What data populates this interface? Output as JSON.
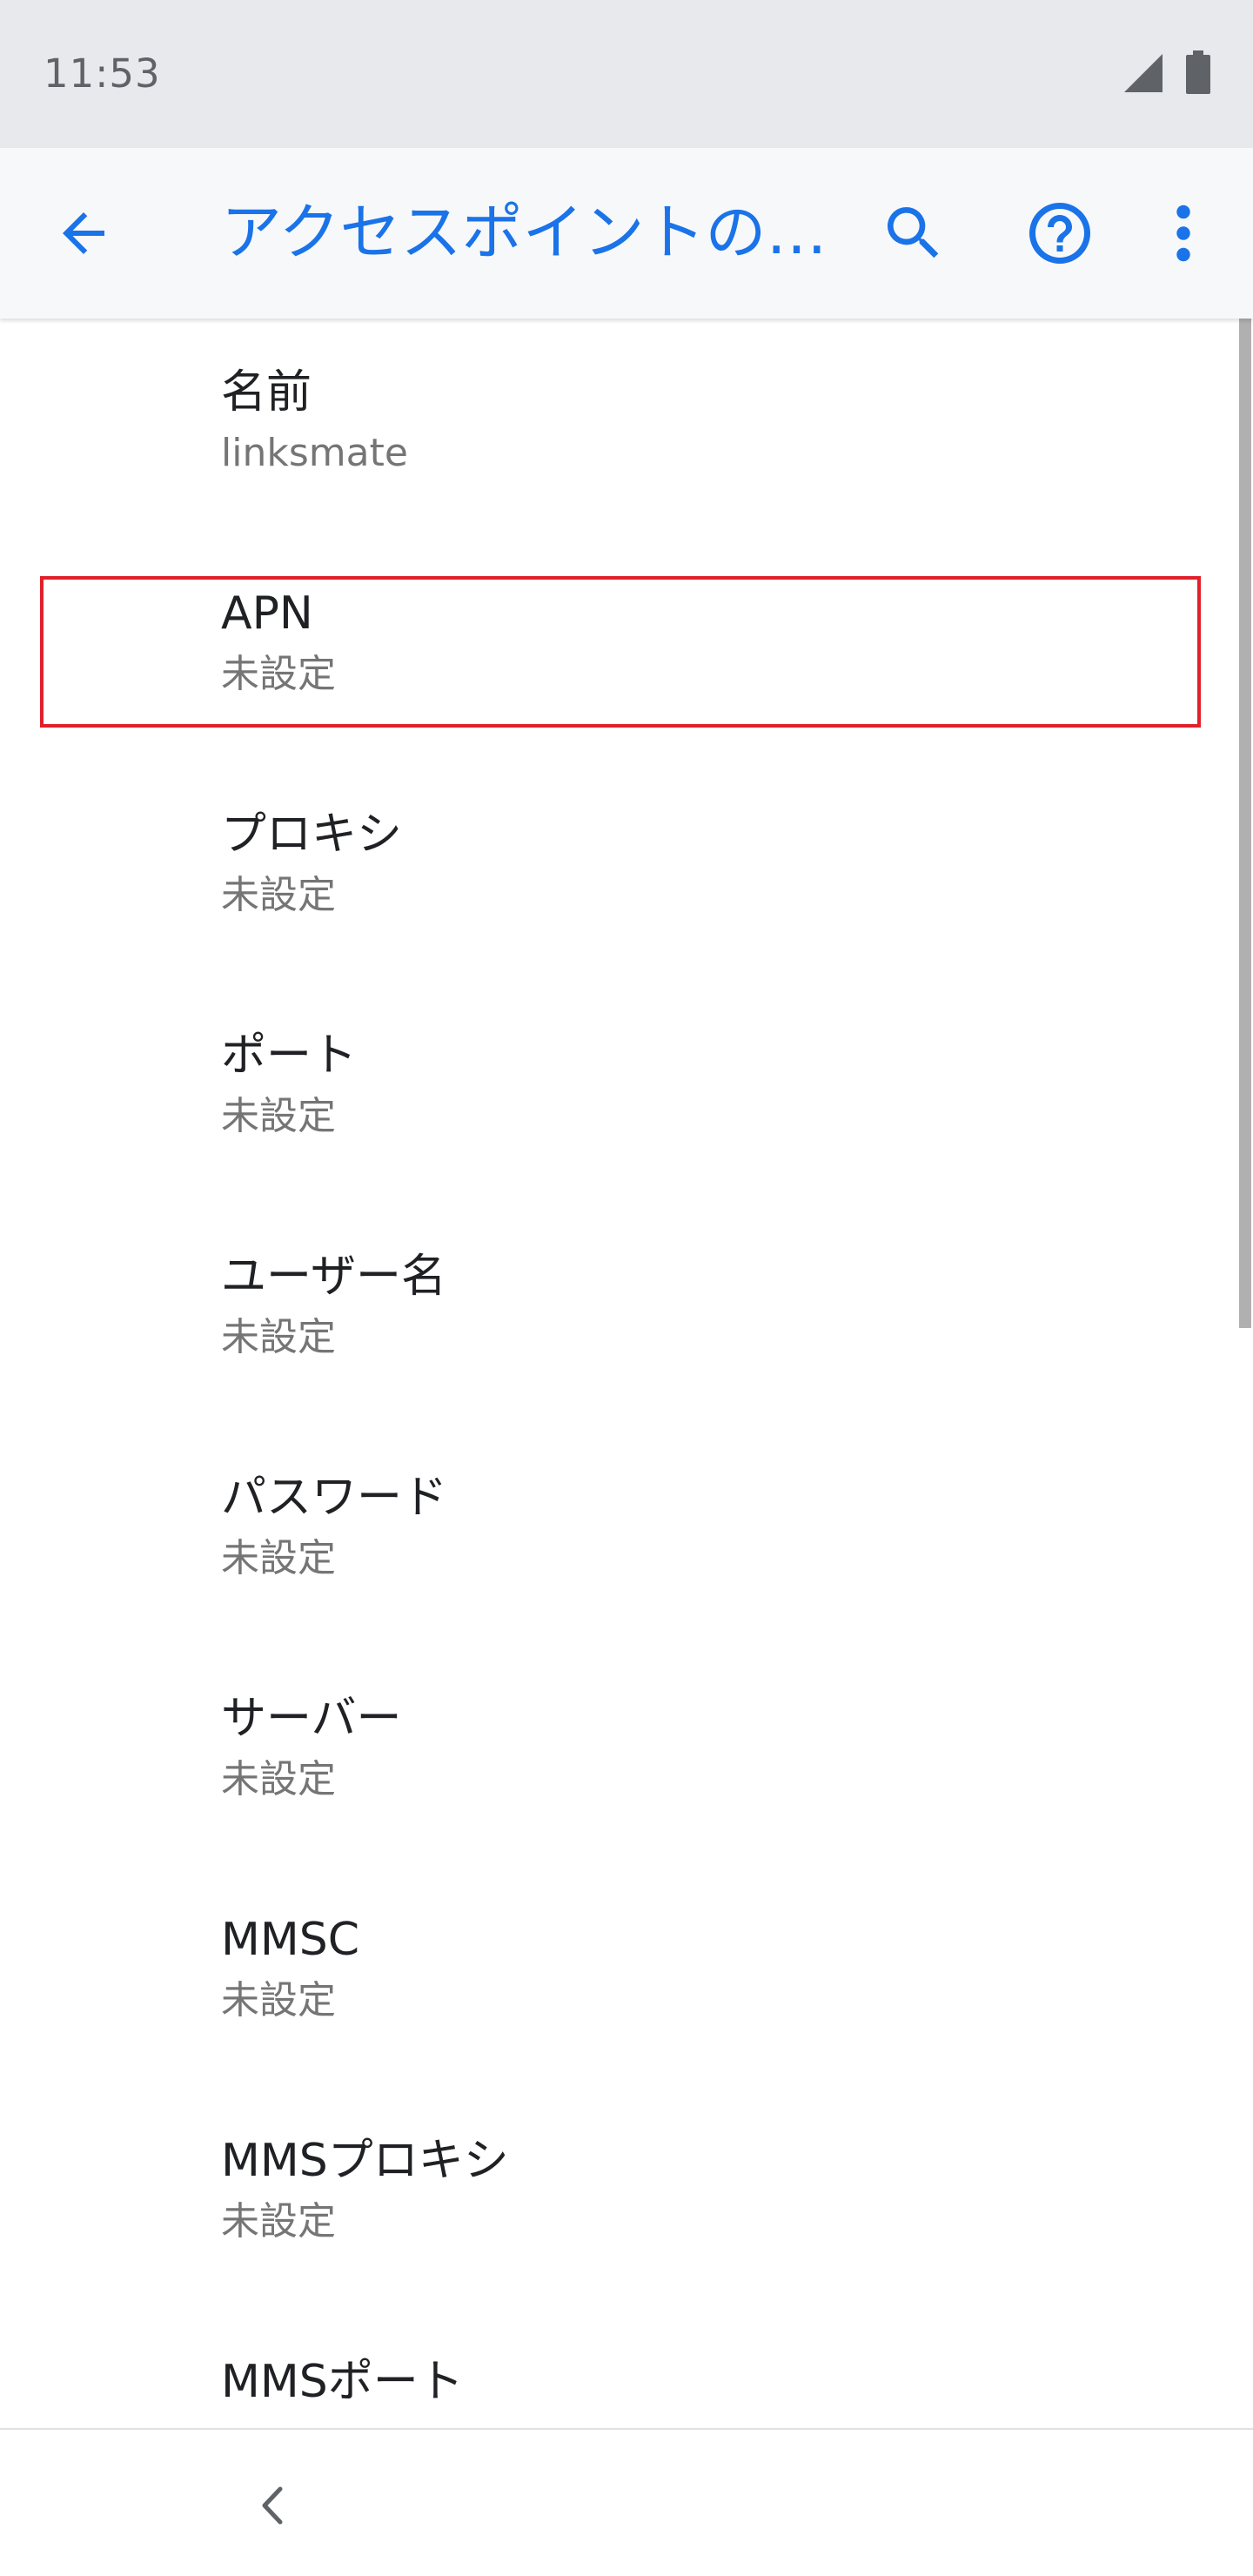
{
  "status_bar": {
    "time": "11:53",
    "signal_icon": "cell-signal-icon",
    "battery_icon": "battery-icon"
  },
  "app_bar": {
    "title": "アクセスポイントの…",
    "back_icon": "arrow-back-icon",
    "search_icon": "search-icon",
    "help_icon": "help-icon",
    "more_icon": "more-vert-icon"
  },
  "settings": {
    "items": [
      {
        "title": "名前",
        "summary": "linksmate"
      },
      {
        "title": "APN",
        "summary": "未設定"
      },
      {
        "title": "プロキシ",
        "summary": "未設定"
      },
      {
        "title": "ポート",
        "summary": "未設定"
      },
      {
        "title": "ユーザー名",
        "summary": "未設定"
      },
      {
        "title": "パスワード",
        "summary": "未設定"
      },
      {
        "title": "サーバー",
        "summary": "未設定"
      },
      {
        "title": "MMSC",
        "summary": "未設定"
      },
      {
        "title": "MMSプロキシ",
        "summary": "未設定"
      },
      {
        "title": "MMSポート",
        "summary": ""
      }
    ]
  },
  "nav_bar": {
    "back_icon": "nav-back-chevron-icon"
  },
  "colors": {
    "accent": "#1a73e8",
    "highlight": "#e0202a",
    "status_bar_bg": "#e8e9ec",
    "app_bar_bg": "#f7f8fa",
    "title_text": "#202124",
    "summary_text": "#757575"
  }
}
